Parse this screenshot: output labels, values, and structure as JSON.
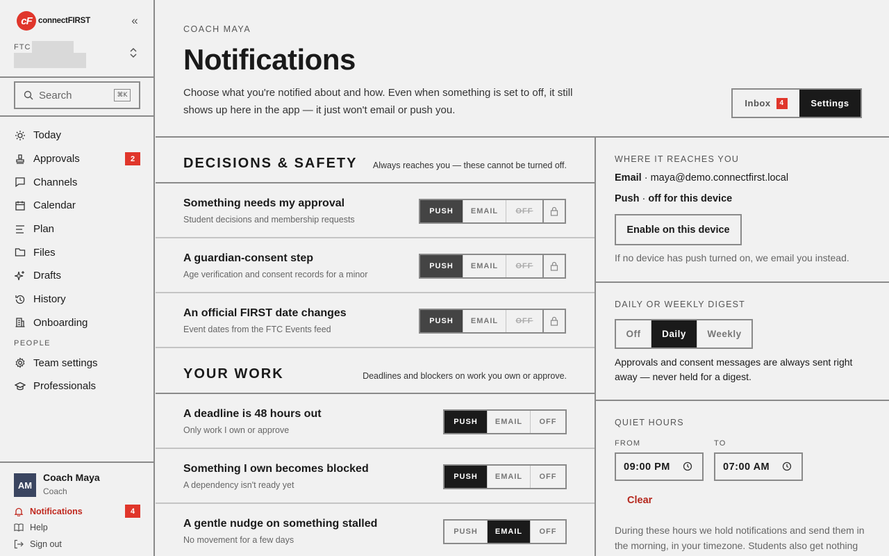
{
  "brand": {
    "mark": "cF",
    "name": "connectFIRST"
  },
  "sidebar": {
    "team_label": "FTC",
    "search_placeholder": "Search",
    "search_shortcut": "⌘K",
    "items": [
      {
        "label": "Today",
        "icon": "sun-icon"
      },
      {
        "label": "Approvals",
        "icon": "stamp-icon",
        "badge": "2"
      },
      {
        "label": "Channels",
        "icon": "chat-icon"
      },
      {
        "label": "Calendar",
        "icon": "calendar-icon"
      },
      {
        "label": "Plan",
        "icon": "list-icon"
      },
      {
        "label": "Files",
        "icon": "folder-icon"
      },
      {
        "label": "Drafts",
        "icon": "sparkle-icon"
      },
      {
        "label": "History",
        "icon": "history-icon"
      },
      {
        "label": "Onboarding",
        "icon": "building-icon"
      }
    ],
    "people_label": "PEOPLE",
    "people_items": [
      {
        "label": "Team settings",
        "icon": "gear-icon"
      },
      {
        "label": "Professionals",
        "icon": "graduation-cap-icon"
      }
    ],
    "user": {
      "initials": "AM",
      "name": "Coach Maya",
      "role": "Coach"
    },
    "footer": [
      {
        "label": "Notifications",
        "icon": "bell-icon",
        "badge": "4",
        "active": true
      },
      {
        "label": "Help",
        "icon": "book-icon"
      },
      {
        "label": "Sign out",
        "icon": "sign-out-icon"
      }
    ]
  },
  "header": {
    "eyebrow": "COACH MAYA",
    "title": "Notifications",
    "description": "Choose what you're notified about and how. Even when something is set to off, it still shows up here in the app — it just won't email or push you.",
    "tabs": {
      "inbox": "Inbox",
      "inbox_badge": "4",
      "settings": "Settings",
      "active": "Settings"
    }
  },
  "options": {
    "push": "PUSH",
    "email": "EMAIL",
    "off": "OFF"
  },
  "sections": [
    {
      "title": "DECISIONS & SAFETY",
      "note": "Always reaches you — these cannot be turned off.",
      "locked": true,
      "rows": [
        {
          "title": "Something needs my approval",
          "subtitle": "Student decisions and membership requests",
          "selected": "PUSH"
        },
        {
          "title": "A guardian-consent step",
          "subtitle": "Age verification and consent records for a minor",
          "selected": "PUSH"
        },
        {
          "title": "An official FIRST date changes",
          "subtitle": "Event dates from the FTC Events feed",
          "selected": "PUSH"
        }
      ]
    },
    {
      "title": "YOUR WORK",
      "note": "Deadlines and blockers on work you own or approve.",
      "locked": false,
      "rows": [
        {
          "title": "A deadline is 48 hours out",
          "subtitle": "Only work I own or approve",
          "selected": "PUSH"
        },
        {
          "title": "Something I own becomes blocked",
          "subtitle": "A dependency isn't ready yet",
          "selected": "PUSH"
        },
        {
          "title": "A gentle nudge on something stalled",
          "subtitle": "No movement for a few days",
          "selected": "EMAIL"
        }
      ]
    }
  ],
  "reach": {
    "eyebrow": "WHERE IT REACHES YOU",
    "email_label": "Email",
    "email_value": "maya@demo.connectfirst.local",
    "push_label": "Push",
    "push_value": "off for this device",
    "enable_button": "Enable on this device",
    "note": "If no device has push turned on, we email you instead."
  },
  "digest": {
    "eyebrow": "DAILY OR WEEKLY DIGEST",
    "options": [
      "Off",
      "Daily",
      "Weekly"
    ],
    "selected": "Daily",
    "note": "Approvals and consent messages are always sent right away — never held for a digest."
  },
  "quiet": {
    "eyebrow": "QUIET HOURS",
    "from_label": "FROM",
    "to_label": "TO",
    "from_value": "09:00 PM",
    "to_value": "07:00 AM",
    "clear": "Clear",
    "description": "During these hours we hold notifications and send them in the morning, in your timezone. Students also get nothing"
  },
  "colors": {
    "accent": "#e0362b",
    "dark": "#1a1a1a",
    "border": "#8a8a8a",
    "background": "#f1f1f1"
  }
}
